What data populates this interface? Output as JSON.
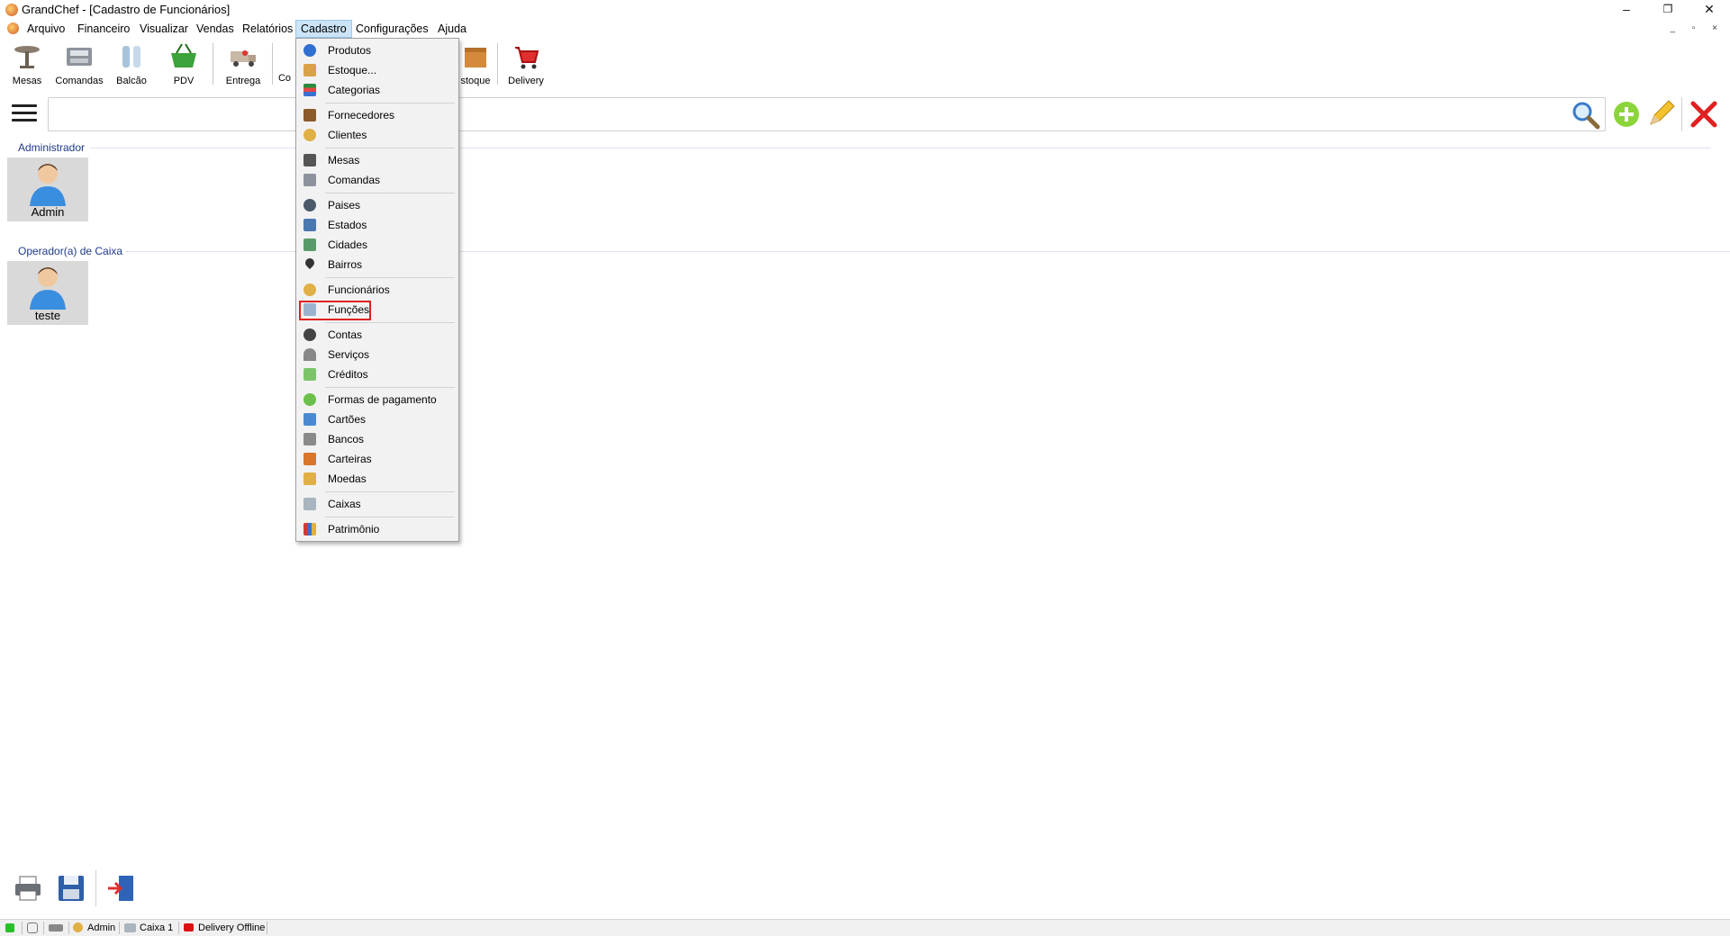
{
  "window": {
    "title": "GrandChef - [Cadastro de Funcionários]",
    "minimize": "–",
    "maximize": "❐",
    "close": "✕",
    "mdi_controls": "_ ▫ ×"
  },
  "menubar": {
    "items": [
      "Arquivo",
      "Financeiro",
      "Visualizar",
      "Vendas",
      "Relatórios",
      "Cadastro",
      "Configurações",
      "Ajuda"
    ],
    "active": "Cadastro"
  },
  "toolbar": {
    "items": [
      {
        "label": "Mesas",
        "icon": "table-icon"
      },
      {
        "label": "Comandas",
        "icon": "cash-register-icon"
      },
      {
        "label": "Balcão",
        "icon": "counter-icon"
      },
      {
        "label": "PDV",
        "icon": "basket-icon"
      },
      {
        "label": "Entrega",
        "icon": "delivery-truck-icon"
      },
      {
        "label": "Co",
        "icon": "partial-icon"
      },
      {
        "label": "stoque",
        "icon": "box-icon"
      },
      {
        "label": "Delivery",
        "icon": "cart-icon"
      }
    ]
  },
  "search": {
    "value": "",
    "placeholder": ""
  },
  "groups": [
    {
      "title": "Administrador",
      "employees": [
        {
          "name": "Admin"
        }
      ]
    },
    {
      "title": "Operador(a) de Caixa",
      "employees": [
        {
          "name": "teste"
        }
      ]
    }
  ],
  "cadastro_menu": {
    "items": [
      "Produtos",
      "Estoque...",
      "Categorias",
      "Fornecedores",
      "Clientes",
      "Mesas",
      "Comandas",
      "Paises",
      "Estados",
      "Cidades",
      "Bairros",
      "Funcionários",
      "Funções",
      "Contas",
      "Serviços",
      "Créditos",
      "Formas de pagamento",
      "Cartões",
      "Bancos",
      "Carteiras",
      "Moedas",
      "Caixas",
      "Patrimônio"
    ],
    "highlighted": "Funções",
    "colors": {
      "highlight_border": "#e02020",
      "active_menu_bg": "#cce4f7"
    }
  },
  "statusbar": {
    "user": "Admin",
    "cash": "Caixa 1",
    "delivery": "Delivery Offline"
  }
}
